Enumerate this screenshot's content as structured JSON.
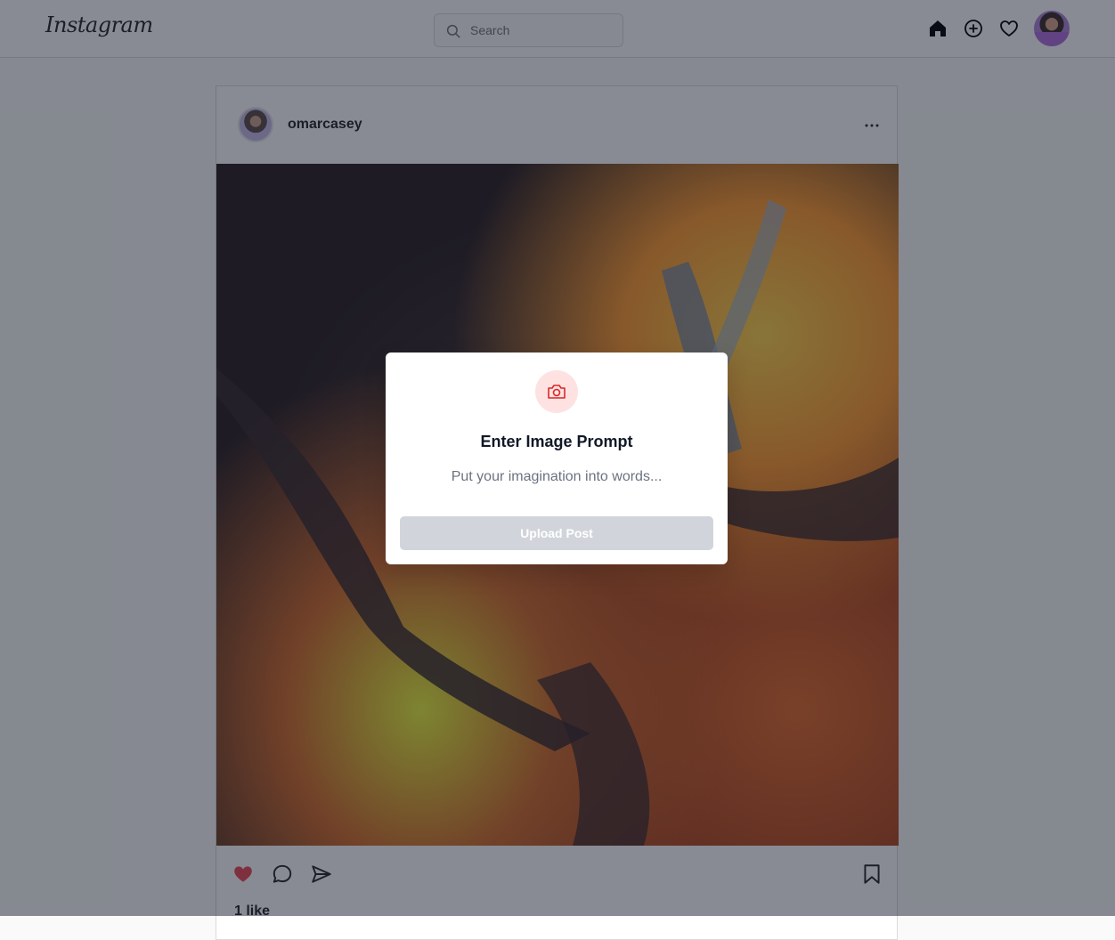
{
  "app": {
    "logo_text": "Instagram"
  },
  "topbar": {
    "search_placeholder": "Search",
    "icons": [
      "home-icon",
      "add-post-icon",
      "heart-icon",
      "profile-avatar"
    ]
  },
  "post": {
    "username": "omarcasey",
    "more_label": "···",
    "likes_text": "1 like",
    "liked": true,
    "like_color": "#ed4956"
  },
  "modal": {
    "title": "Enter Image Prompt",
    "input_placeholder": "Put your imagination into words...",
    "upload_label": "Upload Post",
    "accent": "#dc2626",
    "icon_bg": "#fee2e2"
  }
}
